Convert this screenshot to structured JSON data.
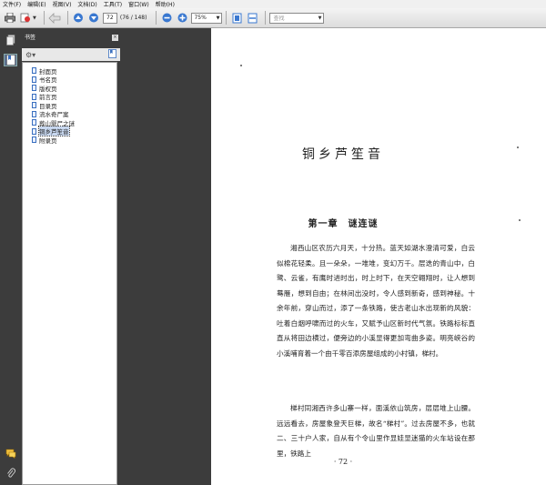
{
  "menu": [
    "文件(F)",
    "编辑(E)",
    "视图(V)",
    "文档(D)",
    "工具(T)",
    "窗口(W)",
    "帮助(H)"
  ],
  "toolbar": {
    "page_current": "72",
    "page_count": "(76 / 148)",
    "zoom": "75%",
    "search_placeholder": "查找"
  },
  "bookmarks": {
    "title": "书签",
    "items": [
      {
        "label": "封面页",
        "selected": false
      },
      {
        "label": "书名页",
        "selected": false
      },
      {
        "label": "版权页",
        "selected": false
      },
      {
        "label": "前言页",
        "selected": false
      },
      {
        "label": "目录页",
        "selected": false
      },
      {
        "label": "流水奇尸案",
        "selected": false
      },
      {
        "label": "葬山婴尸之谜",
        "selected": false
      },
      {
        "label": "铜乡芦笙音",
        "selected": true
      },
      {
        "label": "附录页",
        "selected": false
      }
    ]
  },
  "document": {
    "title": "铜乡芦笙音",
    "chapter": "第一章　谜连谜",
    "paragraph1": "湘西山区农历六月天，十分热。蓝天如湖水澄清可爱，白云似棉花轻柔。且一朵朵，一堆堆，变幻万千。层迭的青山中，白鹭、云雀，有鹰时进时出，时上时下，在天空翱翔时，让人想到蓦雁，想到自由；在林间出没时，令人感到新奇，感到神秘。十余年前，穿山而过，添了一条铁路，使古老山水出现新的风貌：吐着白烟呼啸而过的火车，又赋予山区新时代气氛。铁路标标直直从将田边横过，便旁边的小溪显得更加弯曲多姿。明亮峡谷的小溪哺育着一个由千零百添房屋组成的小村镇，梯村。",
    "paragraph2": "梯村同湘西许多山寨一样，面溪依山筑房，层层堆上山腰。远远看去，房屋象登天巨梯，故名“梯村”。过去房屋不多，也就二、三十户人家，自从有个令山里作显娃显迷猫的火车站设在那里，铁路上",
    "page_number": "· 72 ·"
  }
}
